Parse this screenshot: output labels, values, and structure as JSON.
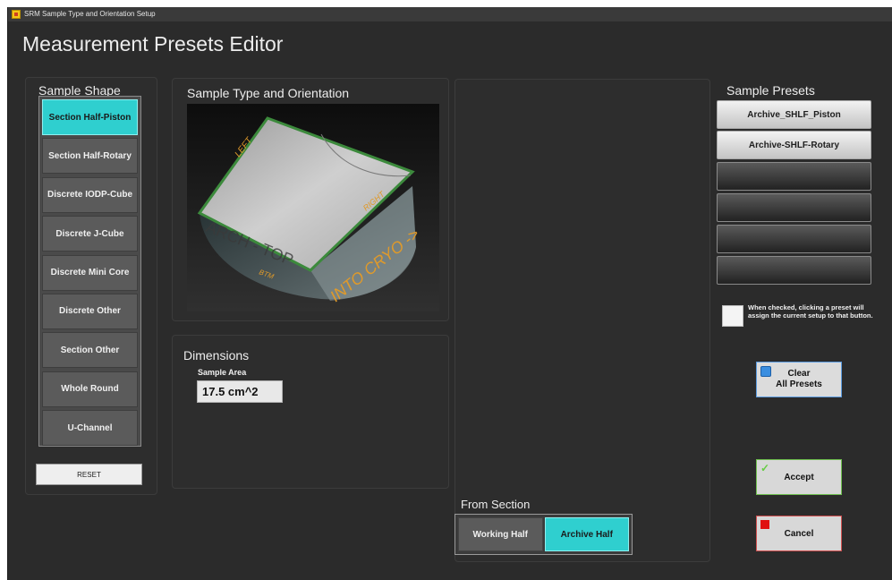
{
  "window": {
    "title": "SRM Sample Type and Orientation Setup"
  },
  "page": {
    "title": "Measurement Presets Editor"
  },
  "sample_shape": {
    "title": "Sample Shape",
    "options": [
      {
        "label": "Section Half-Piston",
        "selected": true
      },
      {
        "label": "Section Half-Rotary",
        "selected": false
      },
      {
        "label": "Discrete IODP-Cube",
        "selected": false
      },
      {
        "label": "Discrete J-Cube",
        "selected": false
      },
      {
        "label": "Discrete Mini Core",
        "selected": false
      },
      {
        "label": "Discrete Other",
        "selected": false
      },
      {
        "label": "Section Other",
        "selected": false
      },
      {
        "label": "Whole Round",
        "selected": false
      },
      {
        "label": "U-Channel",
        "selected": false
      }
    ],
    "reset_label": "RESET"
  },
  "orientation": {
    "title": "Sample Type and Orientation",
    "labels": {
      "left": "LEFT",
      "right": "RIGHT",
      "top": "ARCH - TOP",
      "bottom": "BTM",
      "direction": "INTO CRYO ->"
    }
  },
  "dimensions": {
    "title": "Dimensions",
    "sample_area_label": "Sample Area",
    "sample_area_value": "17.5 cm^2"
  },
  "from_section": {
    "title": "From Section",
    "options": [
      {
        "label": "Working Half",
        "selected": false
      },
      {
        "label": "Archive Half",
        "selected": true
      }
    ]
  },
  "presets": {
    "title": "Sample Presets",
    "buttons": [
      "Archive_SHLF_Piston",
      "Archive-SHLF-Rotary",
      "",
      "",
      "",
      ""
    ],
    "assign_checkbox_checked": false,
    "assign_note": "When checked, clicking a preset will assign the current setup to that button.",
    "clear_label": "Clear\nAll Presets"
  },
  "actions": {
    "accept_label": "Accept",
    "cancel_label": "Cancel"
  },
  "colors": {
    "accent_cyan": "#2fcfcf",
    "background": "#2b2b2b",
    "orange_text": "#e09a2a",
    "accept_icon": "#66cc44",
    "cancel_icon": "#e01010",
    "clear_icon": "#3a8ee0"
  }
}
